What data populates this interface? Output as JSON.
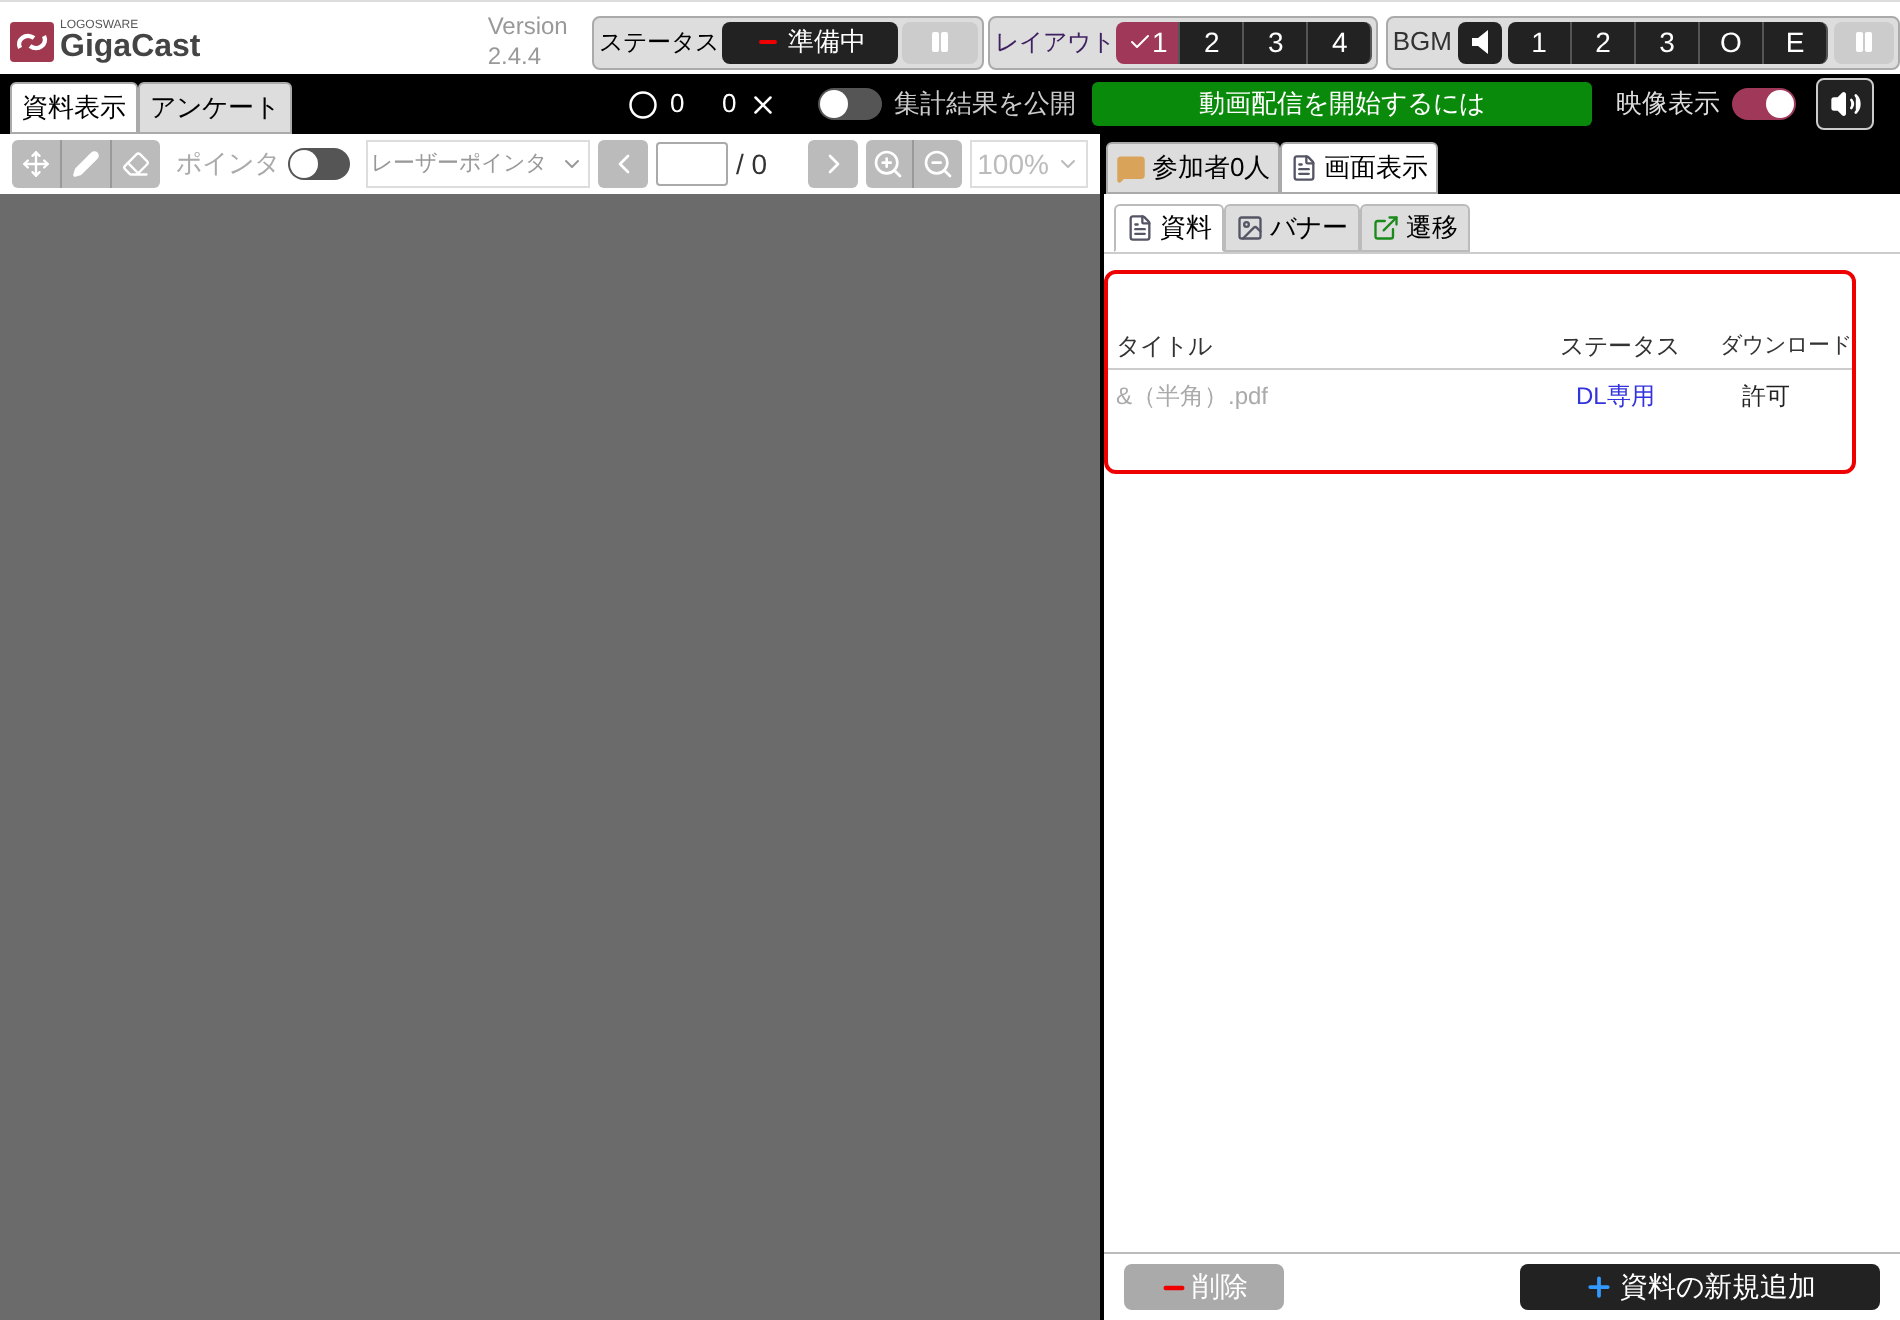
{
  "logo": {
    "maker": "LOGOSWARE",
    "name": "GigaCast"
  },
  "version": {
    "label": "Version",
    "number": "2.4.4"
  },
  "status": {
    "label": "ステータス",
    "value": "準備中"
  },
  "layout": {
    "label": "レイアウト",
    "options": [
      {
        "label": "1",
        "selected": true
      },
      {
        "label": "2",
        "selected": false
      },
      {
        "label": "3",
        "selected": false
      },
      {
        "label": "4",
        "selected": false
      }
    ]
  },
  "bgm": {
    "label": "BGM",
    "tracks": [
      {
        "label": "1",
        "selected": false
      },
      {
        "label": "2",
        "selected": false
      },
      {
        "label": "3",
        "selected": false
      },
      {
        "label": "O",
        "selected": false
      },
      {
        "label": "E",
        "selected": false
      }
    ]
  },
  "main_tabs": [
    {
      "label": "資料表示",
      "selected": true
    },
    {
      "label": "アンケート",
      "selected": false
    }
  ],
  "counts": {
    "correct": "0",
    "wrong": "0"
  },
  "publish_toggle": {
    "label": "集計結果を公開",
    "on": false
  },
  "start_button": "動画配信を開始するには",
  "video_toggle": {
    "label": "映像表示",
    "on": true
  },
  "toolbar": {
    "pointer_label": "ポインタ",
    "pointer_on": false,
    "pointer_select": "レーザーポインタ",
    "page_total": "/ 0",
    "zoom": "100%"
  },
  "right_tabs": [
    {
      "label": "参加者0人",
      "selected": false,
      "kind": "chat"
    },
    {
      "label": "画面表示",
      "selected": true,
      "kind": "doc"
    }
  ],
  "sub_tabs": [
    {
      "label": "資料",
      "selected": true,
      "kind": "doc"
    },
    {
      "label": "バナー",
      "selected": false,
      "kind": "image"
    },
    {
      "label": "遷移",
      "selected": false,
      "kind": "link"
    }
  ],
  "table": {
    "columns": [
      "タイトル",
      "ステータス",
      "ダウンロード"
    ],
    "rows": [
      {
        "title": "&（半角）.pdf",
        "status": "DL専用",
        "download": "許可"
      }
    ]
  },
  "delete_button": {
    "label": "削除",
    "disabled": true
  },
  "add_button": "資料の新規追加"
}
